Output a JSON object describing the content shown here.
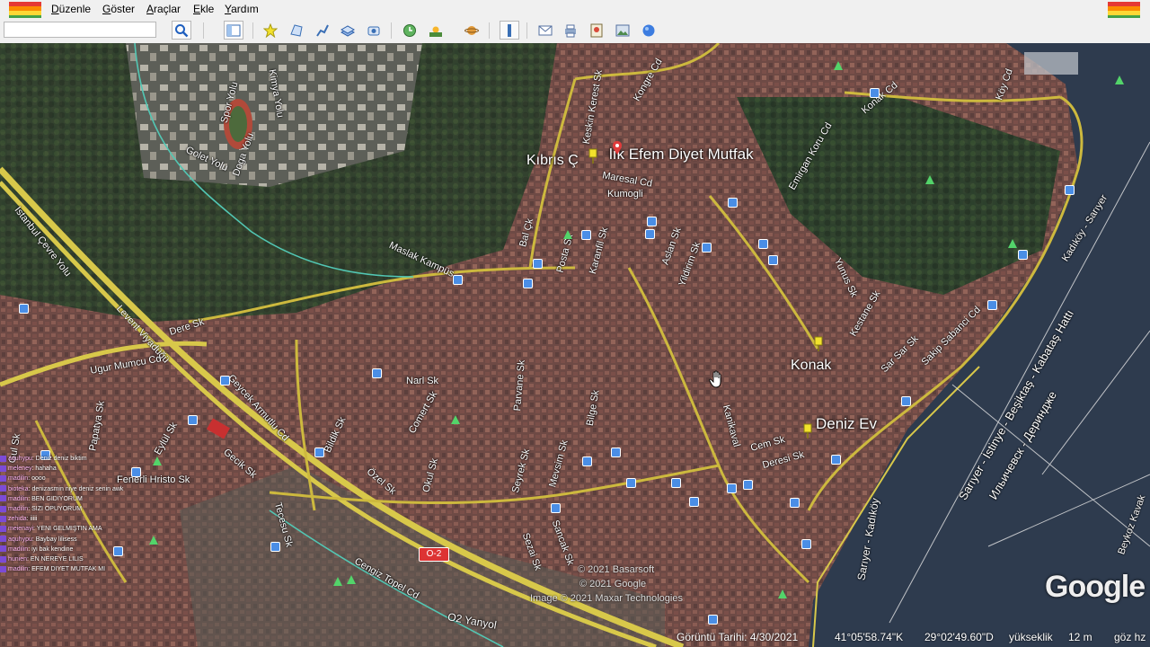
{
  "menu": {
    "items": [
      "Düzenle",
      "Göster",
      "Araçlar",
      "Ekle",
      "Yardım"
    ],
    "underline": [
      "D",
      "G",
      "A",
      "E",
      "Y"
    ]
  },
  "toolbar": {
    "search_placeholder": "",
    "buttons": [
      "search-icon",
      "sidebar-icon",
      "placemark-icon",
      "polygon-icon",
      "path-icon",
      "overlay-icon",
      "tour-icon",
      "history-icon",
      "sunlight-icon",
      "planets-icon",
      "ruler-icon",
      "email-icon",
      "print-icon",
      "save-map-icon",
      "save-image-icon",
      "maps-icon"
    ]
  },
  "map": {
    "place_labels": {
      "kibris": "Kıbrıs Ç",
      "efem": "lık Efem Diyet Mutfak",
      "konak": "Konak",
      "deniz_ev": "Deniz Ev"
    },
    "road_labels": [
      "Spor Yolu",
      "Kimya Yolu",
      "Golet Yolu",
      "Doga Yolu",
      "Istanbul Çevre Yolu",
      "Levent Viyadüğü",
      "Dere Sk",
      "Ugur Mumcu Cd",
      "Kongre Cd",
      "Keskin Kerest Sk",
      "Maresal Cd",
      "Kumogli",
      "Bal Çk",
      "Posta Sk",
      "Karanfil Sk",
      "Aslan Sk",
      "Yildirim Sk",
      "Maslak Kampüs",
      "Fenerli Hristo Sk",
      "Emirgan Koru Cd",
      "Konak Cd",
      "Köy Cd",
      "Kestane Sk",
      "Yunus Sk",
      "Sar Sar Sk",
      "Sakip Sabanci Cd",
      "Kadıköy - Sarıyer",
      "Sarıyer - İstinye - Beşiktaş - Kabataş Hattı",
      "Ильичевск - Деринджe",
      "Sarıyer - Kadıköy",
      "Beykoz Kavak",
      "Narl Sk",
      "Parvane Sk",
      "Bilge Sk",
      "Comert Sk",
      "Okul Sk",
      "Seyrek Sk",
      "Özel Sk",
      "Mevsim Sk",
      "Geycek Armutlu Cd",
      "Bildik Sk",
      "Papatya Sk",
      "Gul Sk",
      "Eylül Sk",
      "Cengiz Topel Cd",
      "Sezai Sk",
      "Sancak Sk",
      "Kanikaval",
      "Cem Sk",
      "Deresi Sk",
      "O2 Yanyol",
      "Gecik Sk",
      "Tecesu Sk"
    ],
    "road_shield": "O-2",
    "copyright": [
      "© 2021 Basarsoft",
      "© 2021 Google",
      "Image © 2021 Maxar Technologies"
    ],
    "logo": "Google"
  },
  "status": {
    "imagery_date": "Görüntü Tarihi: 4/30/2021",
    "latitude": "41°05'58.74\"K",
    "longitude": "29°02'49.60\"D",
    "elevation_label": "yükseklik",
    "elevation_value": "12 m",
    "eye_alt_label": "göz hz"
  },
  "chat": [
    {
      "user": "aquhypu",
      "text": "Deniz deniz biktim"
    },
    {
      "user": "meleney",
      "text": "hahaha"
    },
    {
      "user": "madilin",
      "text": "oooo"
    },
    {
      "user": "bioteka",
      "text": "denizasmin niye deniz senin awk"
    },
    {
      "user": "madilin",
      "text": "BEN GIDIYORUM"
    },
    {
      "user": "madilin",
      "text": "SIZI OPUYORUM"
    },
    {
      "user": "zehida",
      "text": "iiiii"
    },
    {
      "user": "meienayi",
      "text": "YENI GELMIŞTIN AMA"
    },
    {
      "user": "aquhypu",
      "text": "Baybay lilisess"
    },
    {
      "user": "madilin",
      "text": "iyi bak kendine"
    },
    {
      "user": "hunien",
      "text": "EN NEREYE LILIS"
    },
    {
      "user": "madilin",
      "text": "EFEM DIYET MUTFAK MI"
    }
  ]
}
